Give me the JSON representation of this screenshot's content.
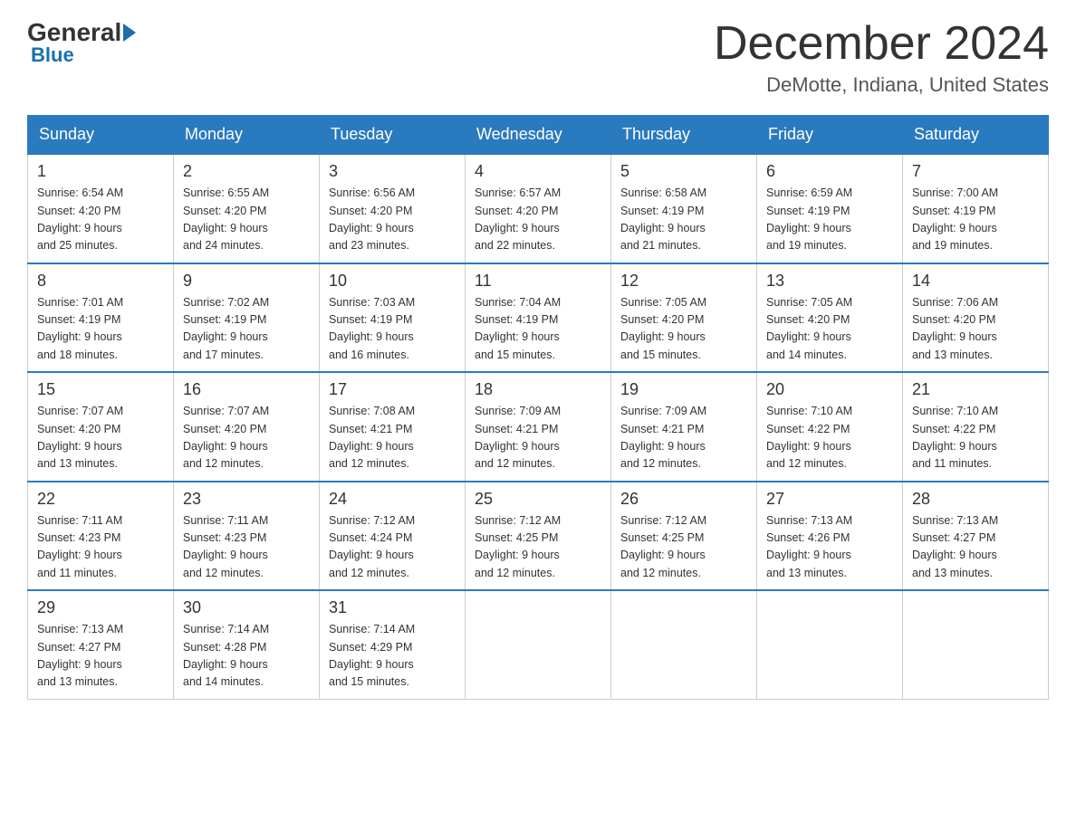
{
  "header": {
    "logo": {
      "general": "General",
      "blue": "Blue"
    },
    "month": "December 2024",
    "location": "DeMotte, Indiana, United States"
  },
  "days_of_week": [
    "Sunday",
    "Monday",
    "Tuesday",
    "Wednesday",
    "Thursday",
    "Friday",
    "Saturday"
  ],
  "weeks": [
    [
      {
        "day": "1",
        "sunrise": "6:54 AM",
        "sunset": "4:20 PM",
        "daylight": "9 hours and 25 minutes."
      },
      {
        "day": "2",
        "sunrise": "6:55 AM",
        "sunset": "4:20 PM",
        "daylight": "9 hours and 24 minutes."
      },
      {
        "day": "3",
        "sunrise": "6:56 AM",
        "sunset": "4:20 PM",
        "daylight": "9 hours and 23 minutes."
      },
      {
        "day": "4",
        "sunrise": "6:57 AM",
        "sunset": "4:20 PM",
        "daylight": "9 hours and 22 minutes."
      },
      {
        "day": "5",
        "sunrise": "6:58 AM",
        "sunset": "4:19 PM",
        "daylight": "9 hours and 21 minutes."
      },
      {
        "day": "6",
        "sunrise": "6:59 AM",
        "sunset": "4:19 PM",
        "daylight": "9 hours and 19 minutes."
      },
      {
        "day": "7",
        "sunrise": "7:00 AM",
        "sunset": "4:19 PM",
        "daylight": "9 hours and 19 minutes."
      }
    ],
    [
      {
        "day": "8",
        "sunrise": "7:01 AM",
        "sunset": "4:19 PM",
        "daylight": "9 hours and 18 minutes."
      },
      {
        "day": "9",
        "sunrise": "7:02 AM",
        "sunset": "4:19 PM",
        "daylight": "9 hours and 17 minutes."
      },
      {
        "day": "10",
        "sunrise": "7:03 AM",
        "sunset": "4:19 PM",
        "daylight": "9 hours and 16 minutes."
      },
      {
        "day": "11",
        "sunrise": "7:04 AM",
        "sunset": "4:19 PM",
        "daylight": "9 hours and 15 minutes."
      },
      {
        "day": "12",
        "sunrise": "7:05 AM",
        "sunset": "4:20 PM",
        "daylight": "9 hours and 15 minutes."
      },
      {
        "day": "13",
        "sunrise": "7:05 AM",
        "sunset": "4:20 PM",
        "daylight": "9 hours and 14 minutes."
      },
      {
        "day": "14",
        "sunrise": "7:06 AM",
        "sunset": "4:20 PM",
        "daylight": "9 hours and 13 minutes."
      }
    ],
    [
      {
        "day": "15",
        "sunrise": "7:07 AM",
        "sunset": "4:20 PM",
        "daylight": "9 hours and 13 minutes."
      },
      {
        "day": "16",
        "sunrise": "7:07 AM",
        "sunset": "4:20 PM",
        "daylight": "9 hours and 12 minutes."
      },
      {
        "day": "17",
        "sunrise": "7:08 AM",
        "sunset": "4:21 PM",
        "daylight": "9 hours and 12 minutes."
      },
      {
        "day": "18",
        "sunrise": "7:09 AM",
        "sunset": "4:21 PM",
        "daylight": "9 hours and 12 minutes."
      },
      {
        "day": "19",
        "sunrise": "7:09 AM",
        "sunset": "4:21 PM",
        "daylight": "9 hours and 12 minutes."
      },
      {
        "day": "20",
        "sunrise": "7:10 AM",
        "sunset": "4:22 PM",
        "daylight": "9 hours and 12 minutes."
      },
      {
        "day": "21",
        "sunrise": "7:10 AM",
        "sunset": "4:22 PM",
        "daylight": "9 hours and 11 minutes."
      }
    ],
    [
      {
        "day": "22",
        "sunrise": "7:11 AM",
        "sunset": "4:23 PM",
        "daylight": "9 hours and 11 minutes."
      },
      {
        "day": "23",
        "sunrise": "7:11 AM",
        "sunset": "4:23 PM",
        "daylight": "9 hours and 12 minutes."
      },
      {
        "day": "24",
        "sunrise": "7:12 AM",
        "sunset": "4:24 PM",
        "daylight": "9 hours and 12 minutes."
      },
      {
        "day": "25",
        "sunrise": "7:12 AM",
        "sunset": "4:25 PM",
        "daylight": "9 hours and 12 minutes."
      },
      {
        "day": "26",
        "sunrise": "7:12 AM",
        "sunset": "4:25 PM",
        "daylight": "9 hours and 12 minutes."
      },
      {
        "day": "27",
        "sunrise": "7:13 AM",
        "sunset": "4:26 PM",
        "daylight": "9 hours and 13 minutes."
      },
      {
        "day": "28",
        "sunrise": "7:13 AM",
        "sunset": "4:27 PM",
        "daylight": "9 hours and 13 minutes."
      }
    ],
    [
      {
        "day": "29",
        "sunrise": "7:13 AM",
        "sunset": "4:27 PM",
        "daylight": "9 hours and 13 minutes."
      },
      {
        "day": "30",
        "sunrise": "7:14 AM",
        "sunset": "4:28 PM",
        "daylight": "9 hours and 14 minutes."
      },
      {
        "day": "31",
        "sunrise": "7:14 AM",
        "sunset": "4:29 PM",
        "daylight": "9 hours and 15 minutes."
      },
      null,
      null,
      null,
      null
    ]
  ],
  "labels": {
    "sunrise": "Sunrise:",
    "sunset": "Sunset:",
    "daylight": "Daylight:"
  }
}
